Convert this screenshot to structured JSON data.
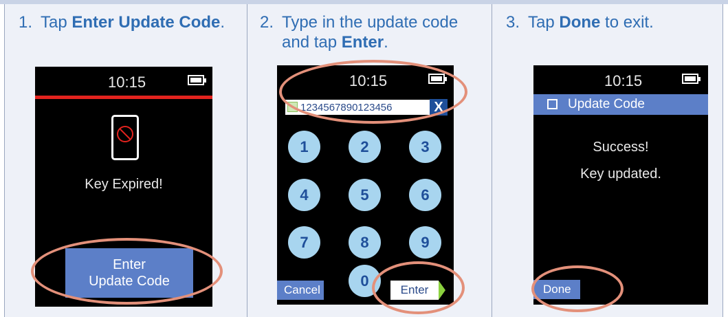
{
  "steps": [
    {
      "number": "1.",
      "pre": "Tap ",
      "bold": "Enter Update Code",
      "post": "."
    },
    {
      "number": "2.",
      "pre": "Type in the update code and tap ",
      "bold": "Enter",
      "post": "."
    },
    {
      "number": "3.",
      "pre": "Tap ",
      "bold": "Done",
      "post": " to exit."
    }
  ],
  "screen1": {
    "time": "10:15",
    "message": "Key Expired!",
    "button_line1": "Enter",
    "button_line2": "Update Code"
  },
  "screen2": {
    "time": "10:15",
    "code_value": "1234567890123456",
    "clear_label": "X",
    "keys": [
      "1",
      "2",
      "3",
      "4",
      "5",
      "6",
      "7",
      "8",
      "9",
      "0"
    ],
    "cancel_label": "Cancel",
    "enter_label": "Enter"
  },
  "screen3": {
    "time": "10:15",
    "title": "Update Code",
    "line1": "Success!",
    "line2": "Key updated.",
    "done_label": "Done"
  },
  "colors": {
    "step_text": "#2f6db3",
    "button_blue": "#5c7fc8",
    "highlight_ring": "#e3907a",
    "alert_red": "#e3231e",
    "key_fill": "#a8d5ef"
  }
}
